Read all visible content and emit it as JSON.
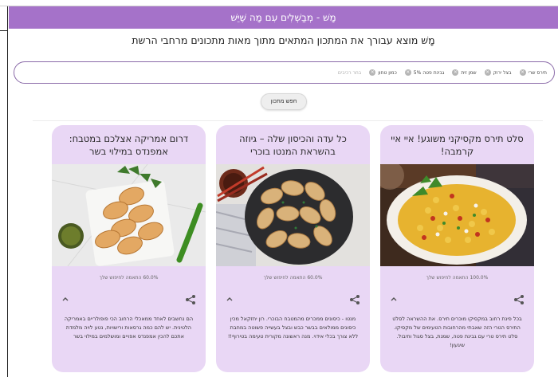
{
  "header": {
    "title": "מָשׁ - מְבַשְּׁלִים עִם מָה שֶּׁיֵּשׁ"
  },
  "subtitle": "מָשׁ מוצא עבורך את המתכון המתאים מתוך מאות מתכונים מרחבי הרשת",
  "search": {
    "chips": [
      "תירס שרי",
      "בצל ירוק",
      "שמן זית",
      "גבינת פטה 5%",
      "כמון טחון"
    ],
    "placeholder": "בחר רכיבים",
    "button_label": "חפש מתכון"
  },
  "cards": [
    {
      "title": "סלט תירס מקסיקני משוגע! איי איי קרמבה!",
      "match": "100.0% התאמה לחיפוש שלך",
      "description": "בכל פינת רחוב במקסיקו מוכרים תירס. את ההשראה לסלט התירס הטרי הזה שאבתי מהרחובות הטעימים של מקסיקו. סלט תירס טרי עם גבינת פטה, שמנת, בצל סגול ותיבול. שיגעון!"
    },
    {
      "title": "כל עדה והכיסון שלה – גיוזה בהשראת המנטו בוכרי",
      "match": "60.0% התאמה לחיפוש שלך",
      "description": "מנטו - כיסונים ממכרים מהמטבח הבוכרי. רון יחזקאל מכין כיסונים ממולאים בבשר כבש ובצל בעשייה פשוטה במחבת ללא צורך בכלי אידוי. מנה ראשונה מקורית טעימה בטירוף!!"
    },
    {
      "title": "דרום אמריקה אצלכם במטבח: אמפנדס במילוי בשר",
      "match": "60.0% התאמה לחיפוש שלך",
      "description": "הם נחשבים לאחד ממאכלי הרחוב הכי פופולריים באמריקה הלטינית. יש להם כמה גרסאות ורישויות, נטע לויה מלמדת אתכם להכין אמפנדס אפויים ומושלמים במילוי בשר"
    }
  ],
  "colors": {
    "header": "#a572c9",
    "card": "#e9d7f5",
    "search_border": "#8a6aa8"
  }
}
